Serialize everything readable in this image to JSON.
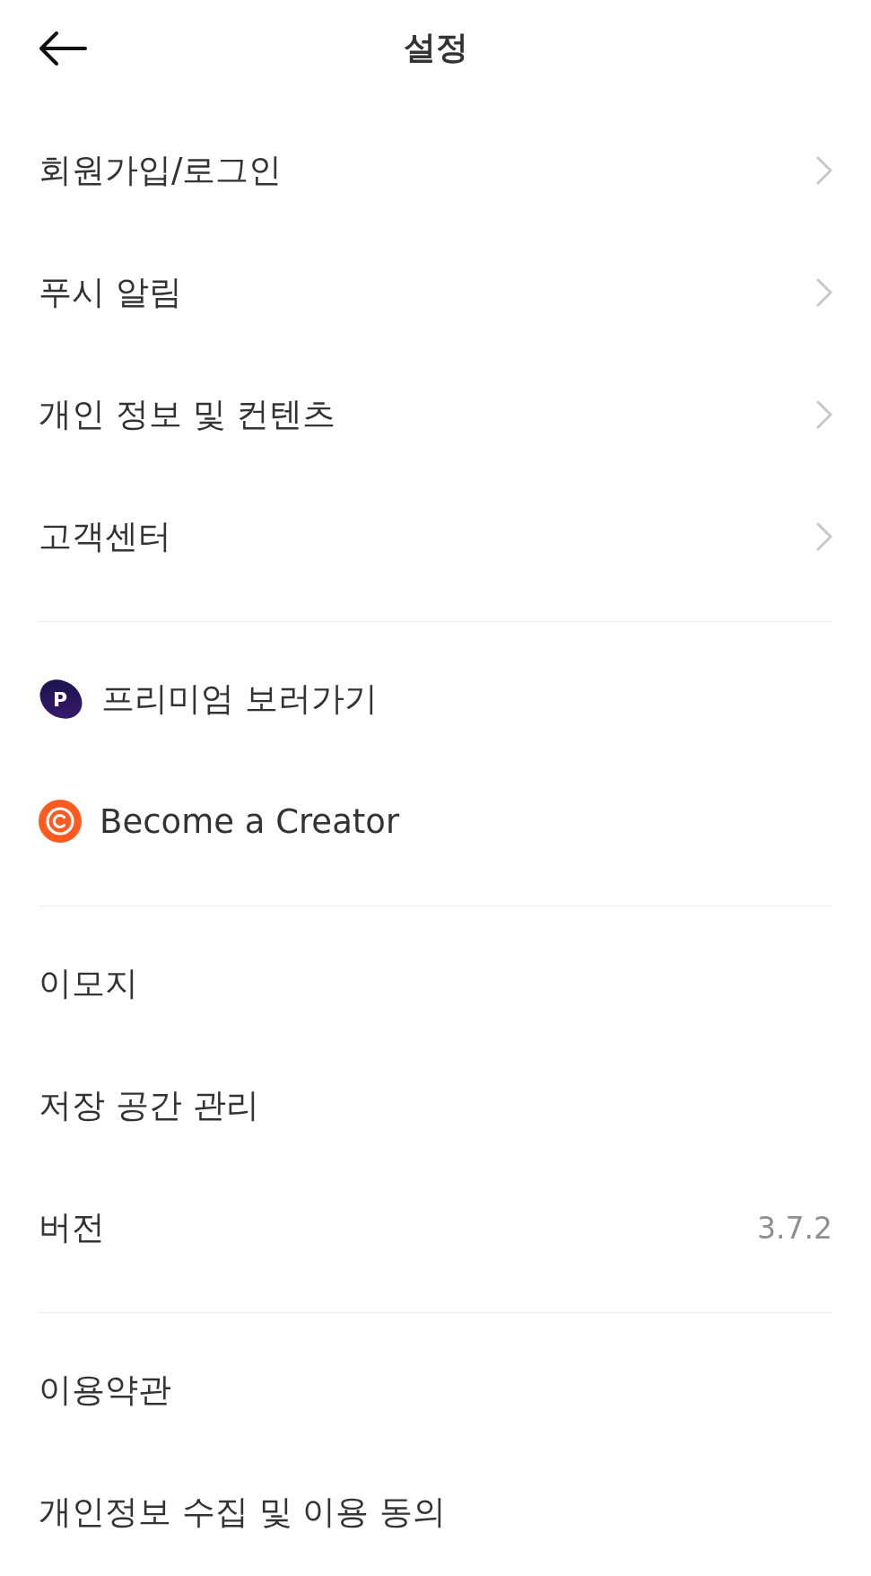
{
  "header": {
    "title": "설정"
  },
  "sections": [
    {
      "items": [
        {
          "kind": "link",
          "label": "회원가입/로그인"
        },
        {
          "kind": "link",
          "label": "푸시 알림"
        },
        {
          "kind": "link",
          "label": "개인 정보 및 컨텐츠"
        },
        {
          "kind": "link",
          "label": "고객센터"
        }
      ]
    },
    {
      "items": [
        {
          "kind": "premium",
          "label": "프리미엄 보러가기",
          "logo_letter": "P"
        },
        {
          "kind": "creator",
          "label": "Become a Creator"
        }
      ]
    },
    {
      "items": [
        {
          "kind": "plain",
          "label": "이모지"
        },
        {
          "kind": "plain",
          "label": "저장 공간 관리"
        },
        {
          "kind": "value",
          "label": "버전",
          "value": "3.7.2"
        }
      ]
    },
    {
      "items": [
        {
          "kind": "plain",
          "label": "이용약관"
        },
        {
          "kind": "plain",
          "label": "개인정보 수집 및 이용 동의"
        }
      ]
    }
  ]
}
